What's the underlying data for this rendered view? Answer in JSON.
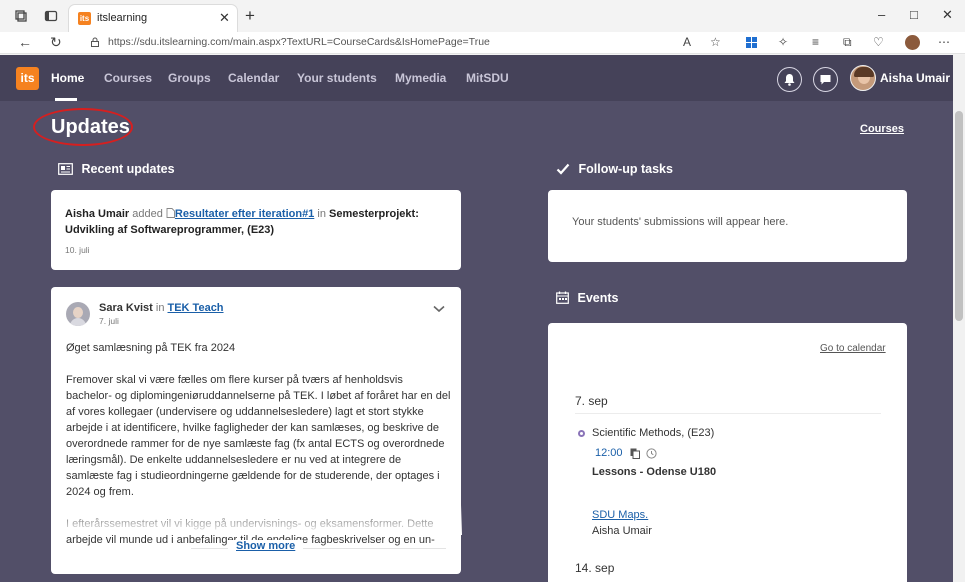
{
  "browser": {
    "tab_title": "itslearning",
    "tab_favicon_text": "its",
    "url": "https://sdu.itslearning.com/main.aspx?TextURL=CourseCards&IsHomePage=True",
    "minimize": "–",
    "maximize": "□",
    "close": "✕",
    "new_tab": "+"
  },
  "nav": {
    "logo": "its",
    "items": [
      "Home",
      "Courses",
      "Groups",
      "Calendar",
      "Your students",
      "Mymedia",
      "MitSDU"
    ],
    "active": "Home",
    "user_name": "Aisha Umair"
  },
  "page": {
    "title": "Updates",
    "courses_link": "Courses"
  },
  "recent_updates": {
    "heading": "Recent updates",
    "item": {
      "actor": "Aisha Umair",
      "verb": "added",
      "file": "Resultater efter iteration#1",
      "prep": "in",
      "course": "Semesterprojekt: Udvikling af Softwareprogrammer, (E23)",
      "date": "10. juli"
    }
  },
  "post": {
    "author": "Sara Kvist",
    "prep": "in",
    "group": "TEK Teach",
    "date": "7. juli",
    "title": "Øget samlæsning på TEK fra 2024",
    "para1": "Fremover skal vi være fælles om flere kurser på tværs af henholdsvis bachelor- og diplomingeniøruddannelserne på TEK. I løbet af foråret har en del af vores kollegaer (undervisere og uddannelsesledere) lagt et stort stykke arbejde i at identificere, hvilke fagligheder der kan samlæses, og beskrive de overordnede rammer for de nye samlæste fag (fx antal ECTS og overordnede læringsmål). De enkelte uddannelsesledere er nu ved at integrere de samlæste fag i studieordningerne gældende for de studerende, der optages i 2024 og frem.",
    "para2": "I efterårssemestret vil vi kigge på undervisnings- og eksamensformer. Dette arbejde vil munde ud i anbefalinger til de endelige fagbeskrivelser og en un-",
    "show_more": "Show more"
  },
  "followup": {
    "heading": "Follow-up tasks",
    "empty_text": "Your students' submissions will appear here."
  },
  "events": {
    "heading": "Events",
    "calendar_link": "Go to calendar",
    "days": [
      {
        "date": "7. sep",
        "event": {
          "title": "Scientific Methods, (E23)",
          "time": "12:00",
          "type": "Lessons - Odense U180",
          "link": "SDU Maps.",
          "person": "Aisha Umair"
        }
      },
      {
        "date": "14. sep"
      }
    ]
  },
  "colors": {
    "brand_orange": "#f58220",
    "nav_bg": "#454259",
    "page_bg": "#524f68",
    "link_blue": "#1a5fa8",
    "highlight_red": "#d61f1f"
  }
}
